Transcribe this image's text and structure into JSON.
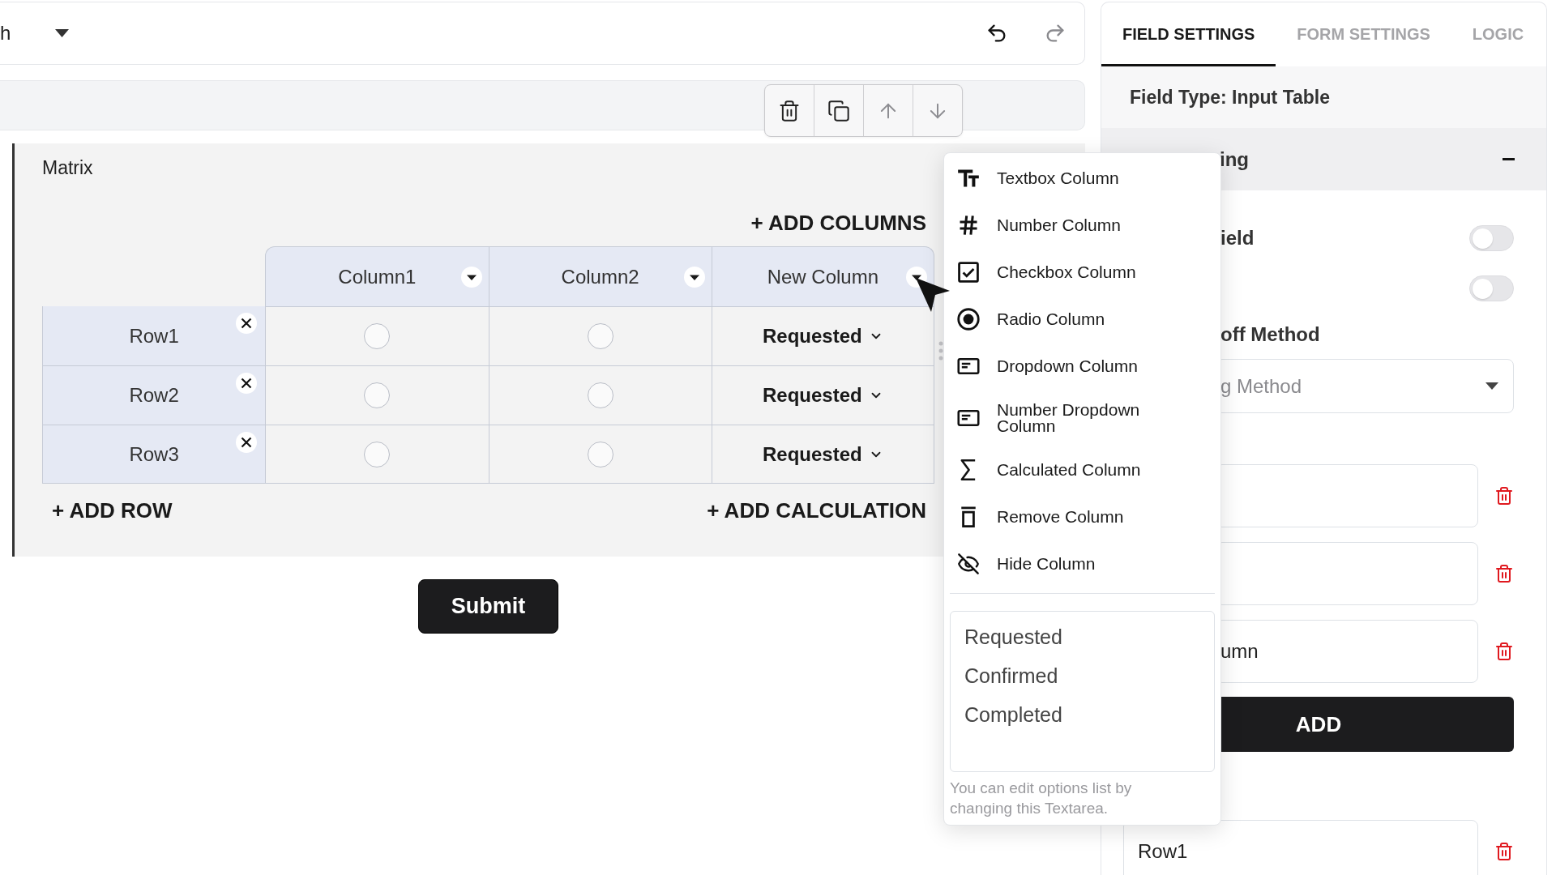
{
  "top_bar": {
    "title": "h",
    "history": [
      {
        "kind": "undo",
        "disabled": false
      },
      {
        "kind": "redo",
        "disabled": true
      }
    ]
  },
  "field_toolbar": [
    {
      "kind": "delete",
      "disabled": false
    },
    {
      "kind": "duplicate",
      "disabled": false
    },
    {
      "kind": "move_up",
      "disabled": true
    },
    {
      "kind": "move_down",
      "disabled": true
    }
  ],
  "matrix": {
    "label": "Matrix",
    "add_columns": "+ ADD COLUMNS",
    "columns": [
      {
        "title": "Column1"
      },
      {
        "title": "Column2"
      },
      {
        "title": "New Column"
      }
    ],
    "rows": [
      {
        "title": "Row1",
        "cells": [
          {
            "kind": "radio",
            "selected": false
          },
          {
            "kind": "radio",
            "selected": false
          },
          {
            "kind": "dropdown",
            "value": "Requested"
          }
        ]
      },
      {
        "title": "Row2",
        "cells": [
          {
            "kind": "radio",
            "selected": false
          },
          {
            "kind": "radio",
            "selected": false
          },
          {
            "kind": "dropdown",
            "value": "Requested"
          }
        ]
      },
      {
        "title": "Row3",
        "cells": [
          {
            "kind": "radio",
            "selected": false
          },
          {
            "kind": "radio",
            "selected": false
          },
          {
            "kind": "dropdown",
            "value": "Requested"
          }
        ]
      }
    ],
    "add_row": "+ ADD ROW",
    "add_calculation": "+ ADD CALCULATION"
  },
  "submit": "Submit",
  "column_menu": {
    "items": [
      {
        "kind": "textbox",
        "label": "Textbox Column"
      },
      {
        "kind": "number",
        "label": "Number Column"
      },
      {
        "kind": "checkbox",
        "label": "Checkbox Column"
      },
      {
        "kind": "radio",
        "label": "Radio Column"
      },
      {
        "kind": "dropdown",
        "label": "Dropdown Column"
      },
      {
        "kind": "number_dropdown",
        "label": "Number Dropdown Column"
      },
      {
        "kind": "calculated",
        "label": "Calculated Column"
      },
      {
        "kind": "remove",
        "label": "Remove Column"
      },
      {
        "kind": "hide",
        "label": "Hide Column"
      }
    ],
    "options": "Requested\nConfirmed\nCompleted",
    "hint": "You can edit options list by changing this Textarea."
  },
  "settings_panel": {
    "tabs": [
      {
        "label": "FIELD SETTINGS",
        "selected": true
      },
      {
        "label": "FORM SETTINGS",
        "selected": false
      },
      {
        "label": "LOGIC",
        "selected": false
      }
    ],
    "field_type": "Field Type: Input Table",
    "section": {
      "title": "ing",
      "expanded": true
    },
    "toggles": [
      {
        "label": "ield",
        "on": false
      },
      {
        "on": false
      }
    ],
    "method": {
      "label": "off Method",
      "placeholder": "g Method"
    },
    "column_fields": [
      {
        "deletable": true
      },
      {
        "deletable": true
      },
      {
        "value": "umn",
        "deletable": true
      }
    ],
    "add_button": "ADD",
    "row_fields": [
      {
        "value": "Row1",
        "deletable": true
      }
    ]
  }
}
